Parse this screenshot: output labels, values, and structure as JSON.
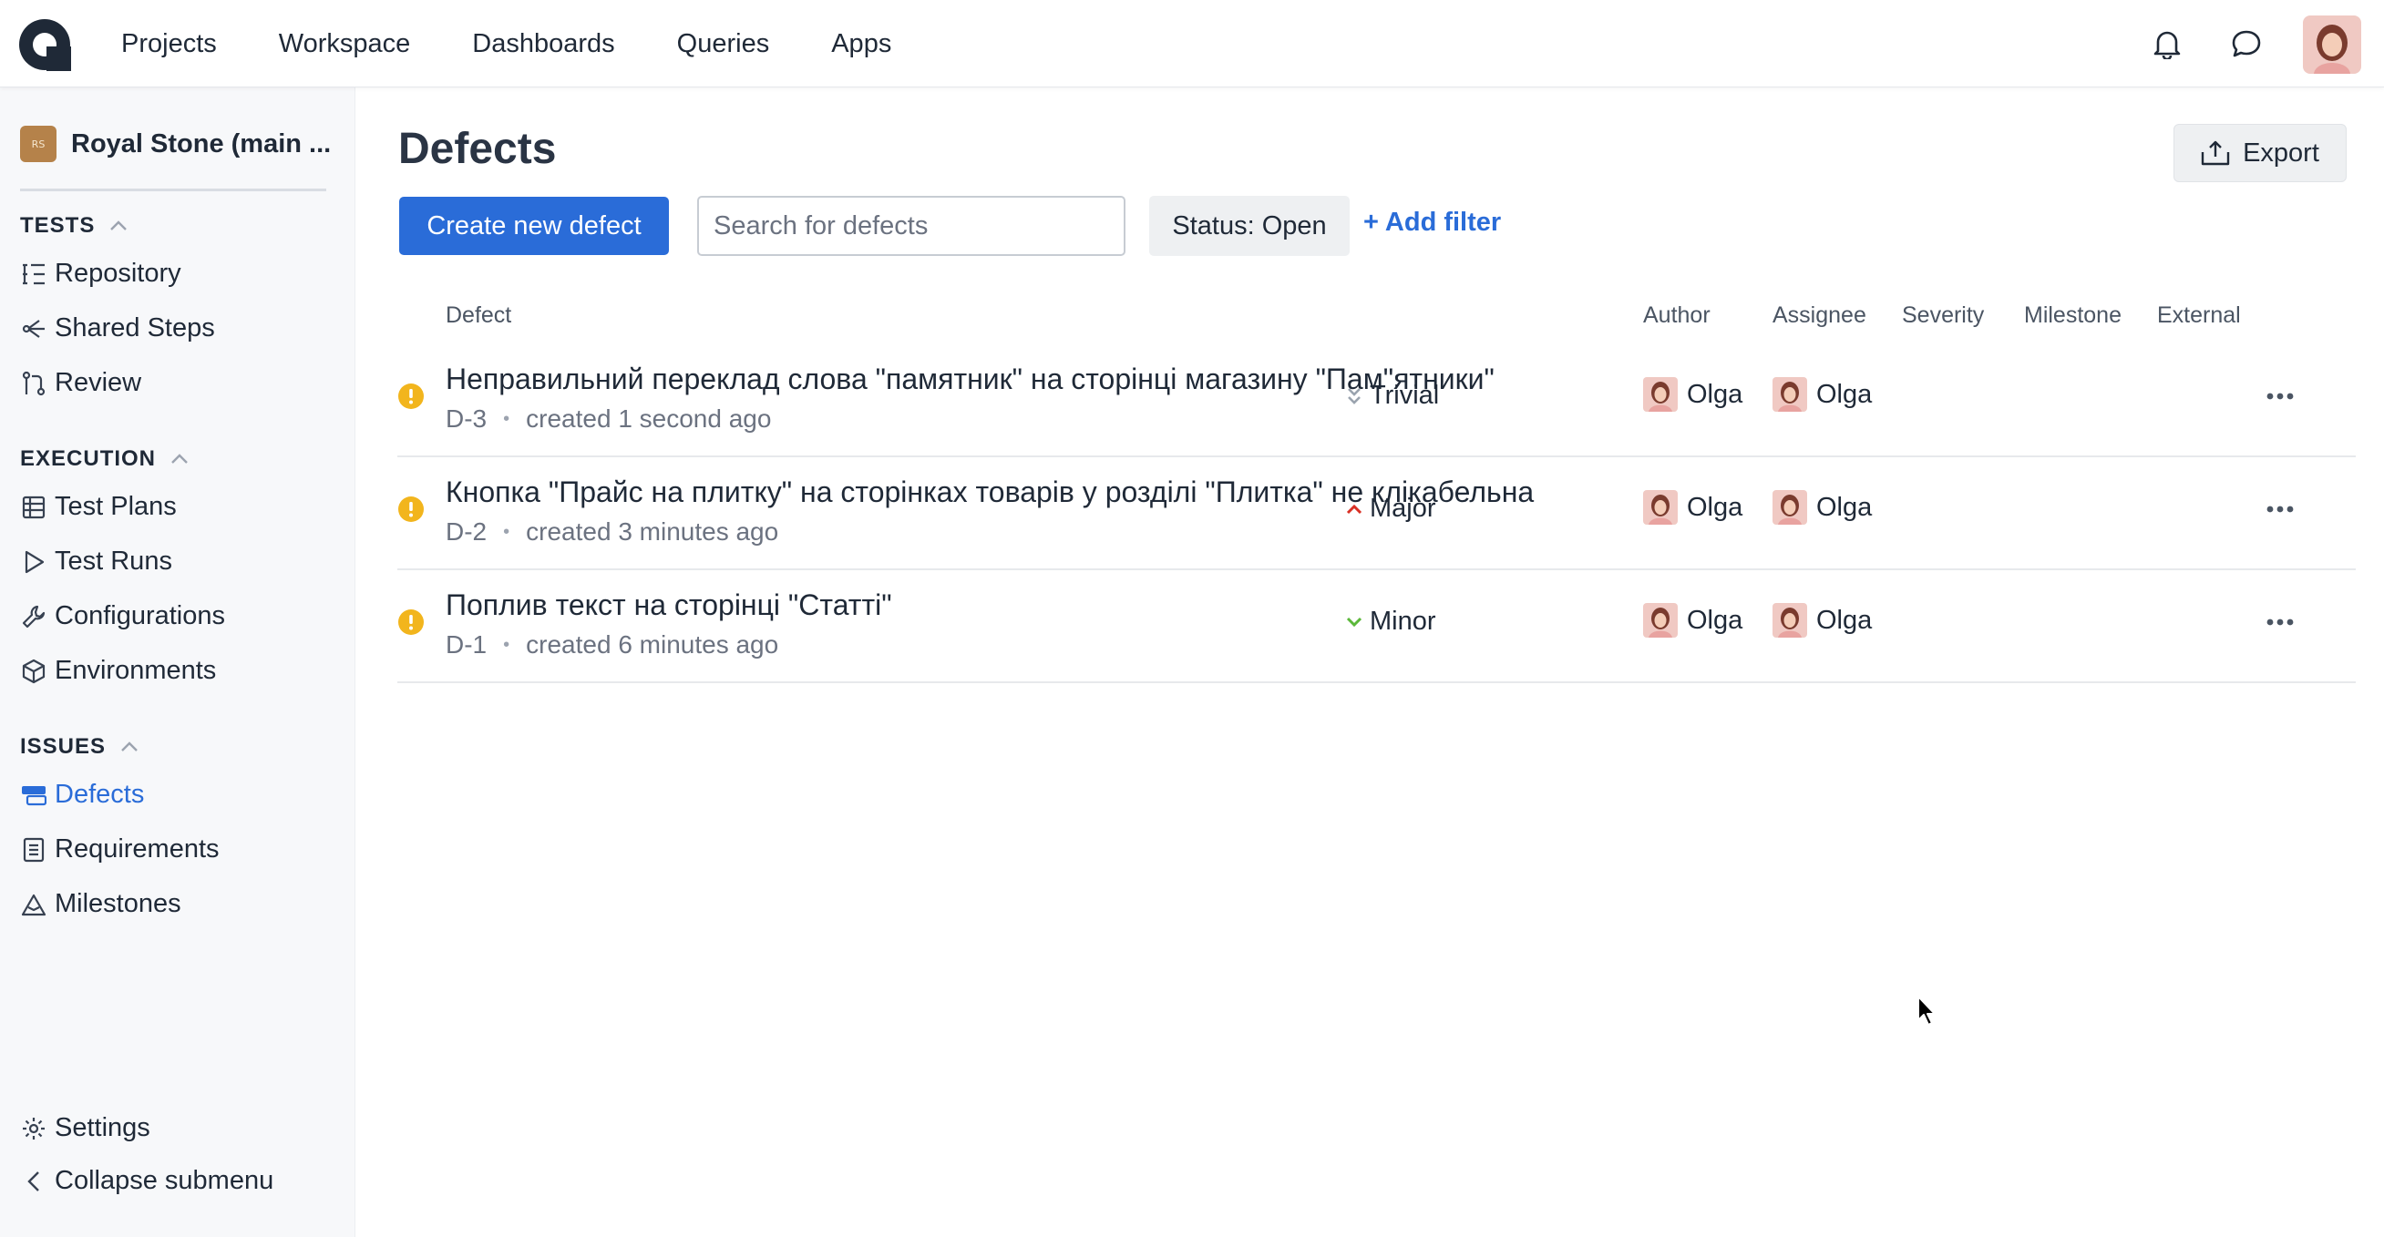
{
  "nav": {
    "items": [
      "Projects",
      "Workspace",
      "Dashboards",
      "Queries",
      "Apps"
    ]
  },
  "sidebar": {
    "project": {
      "badge": "RS",
      "name": "Royal Stone (main ..."
    },
    "sections": {
      "tests": "TESTS",
      "execution": "EXECUTION",
      "issues": "ISSUES"
    },
    "items": {
      "repository": "Repository",
      "shared_steps": "Shared Steps",
      "review": "Review",
      "test_plans": "Test Plans",
      "test_runs": "Test Runs",
      "configurations": "Configurations",
      "environments": "Environments",
      "defects": "Defects",
      "requirements": "Requirements",
      "milestones": "Milestones",
      "settings": "Settings",
      "collapse": "Collapse submenu"
    }
  },
  "page": {
    "title": "Defects",
    "export_label": "Export",
    "create_label": "Create new defect",
    "search_placeholder": "Search for defects",
    "status_filter": "Status: Open",
    "add_filter": "+ Add filter"
  },
  "table": {
    "headers": {
      "defect": "Defect",
      "author": "Author",
      "assignee": "Assignee",
      "severity": "Severity",
      "milestone": "Milestone",
      "external": "External"
    },
    "rows": [
      {
        "title": "Неправильний переклад слова \"памятник\" на сторінці магазину \"Пам\"ятники\"",
        "id": "D-3",
        "created": "created 1 second ago",
        "author": "Olga",
        "assignee": "Olga",
        "severity": "Trivial"
      },
      {
        "title": "Кнопка \"Прайс на плитку\" на сторінках товарів у розділі \"Плитка\" не клікабельна",
        "id": "D-2",
        "created": "created 3 minutes ago",
        "author": "Olga",
        "assignee": "Olga",
        "severity": "Major"
      },
      {
        "title": "Поплив текст на сторінці \"Статті\"",
        "id": "D-1",
        "created": "created 6 minutes ago",
        "author": "Olga",
        "assignee": "Olga",
        "severity": "Minor"
      }
    ]
  },
  "colors": {
    "accent": "#2a6cd8",
    "warning": "#f2b51d",
    "major": "#d93025",
    "minor": "#5bb83a",
    "trivial": "#9aa3ae"
  }
}
